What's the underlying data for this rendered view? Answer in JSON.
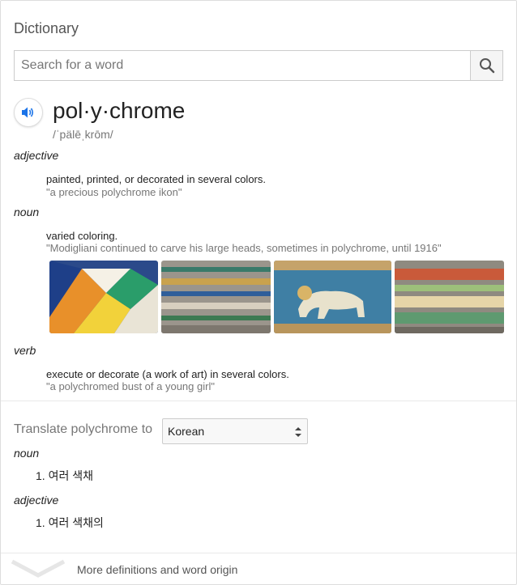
{
  "header": {
    "title": "Dictionary"
  },
  "search": {
    "placeholder": "Search for a word"
  },
  "word": {
    "headword": "pol·y·chrome",
    "phonetic": "/ˈpälēˌkrōm/"
  },
  "senses": [
    {
      "pos": "adjective",
      "definition": "painted, printed, or decorated in several colors.",
      "example": "\"a precious polychrome ikon\""
    },
    {
      "pos": "noun",
      "definition": "varied coloring.",
      "example": "\"Modigliani continued to carve his large heads, sometimes in polychrome, until 1916\""
    },
    {
      "pos": "verb",
      "definition": "execute or decorate (a work of art) in several colors.",
      "example": "\"a polychromed bust of a young girl\""
    }
  ],
  "translate": {
    "label": "Translate polychrome to",
    "language": "Korean",
    "entries": [
      {
        "pos": "noun",
        "items": [
          "1. 여러 색채"
        ]
      },
      {
        "pos": "adjective",
        "items": [
          "1. 여러 색채의"
        ]
      }
    ]
  },
  "footer": {
    "more_label": "More definitions and word origin"
  },
  "icons": {
    "audio": "speaker-icon",
    "search": "search-icon",
    "more": "chevron-down-icon"
  },
  "colors": {
    "accent": "#1a73e8",
    "muted": "#777777",
    "border": "#cccccc"
  }
}
